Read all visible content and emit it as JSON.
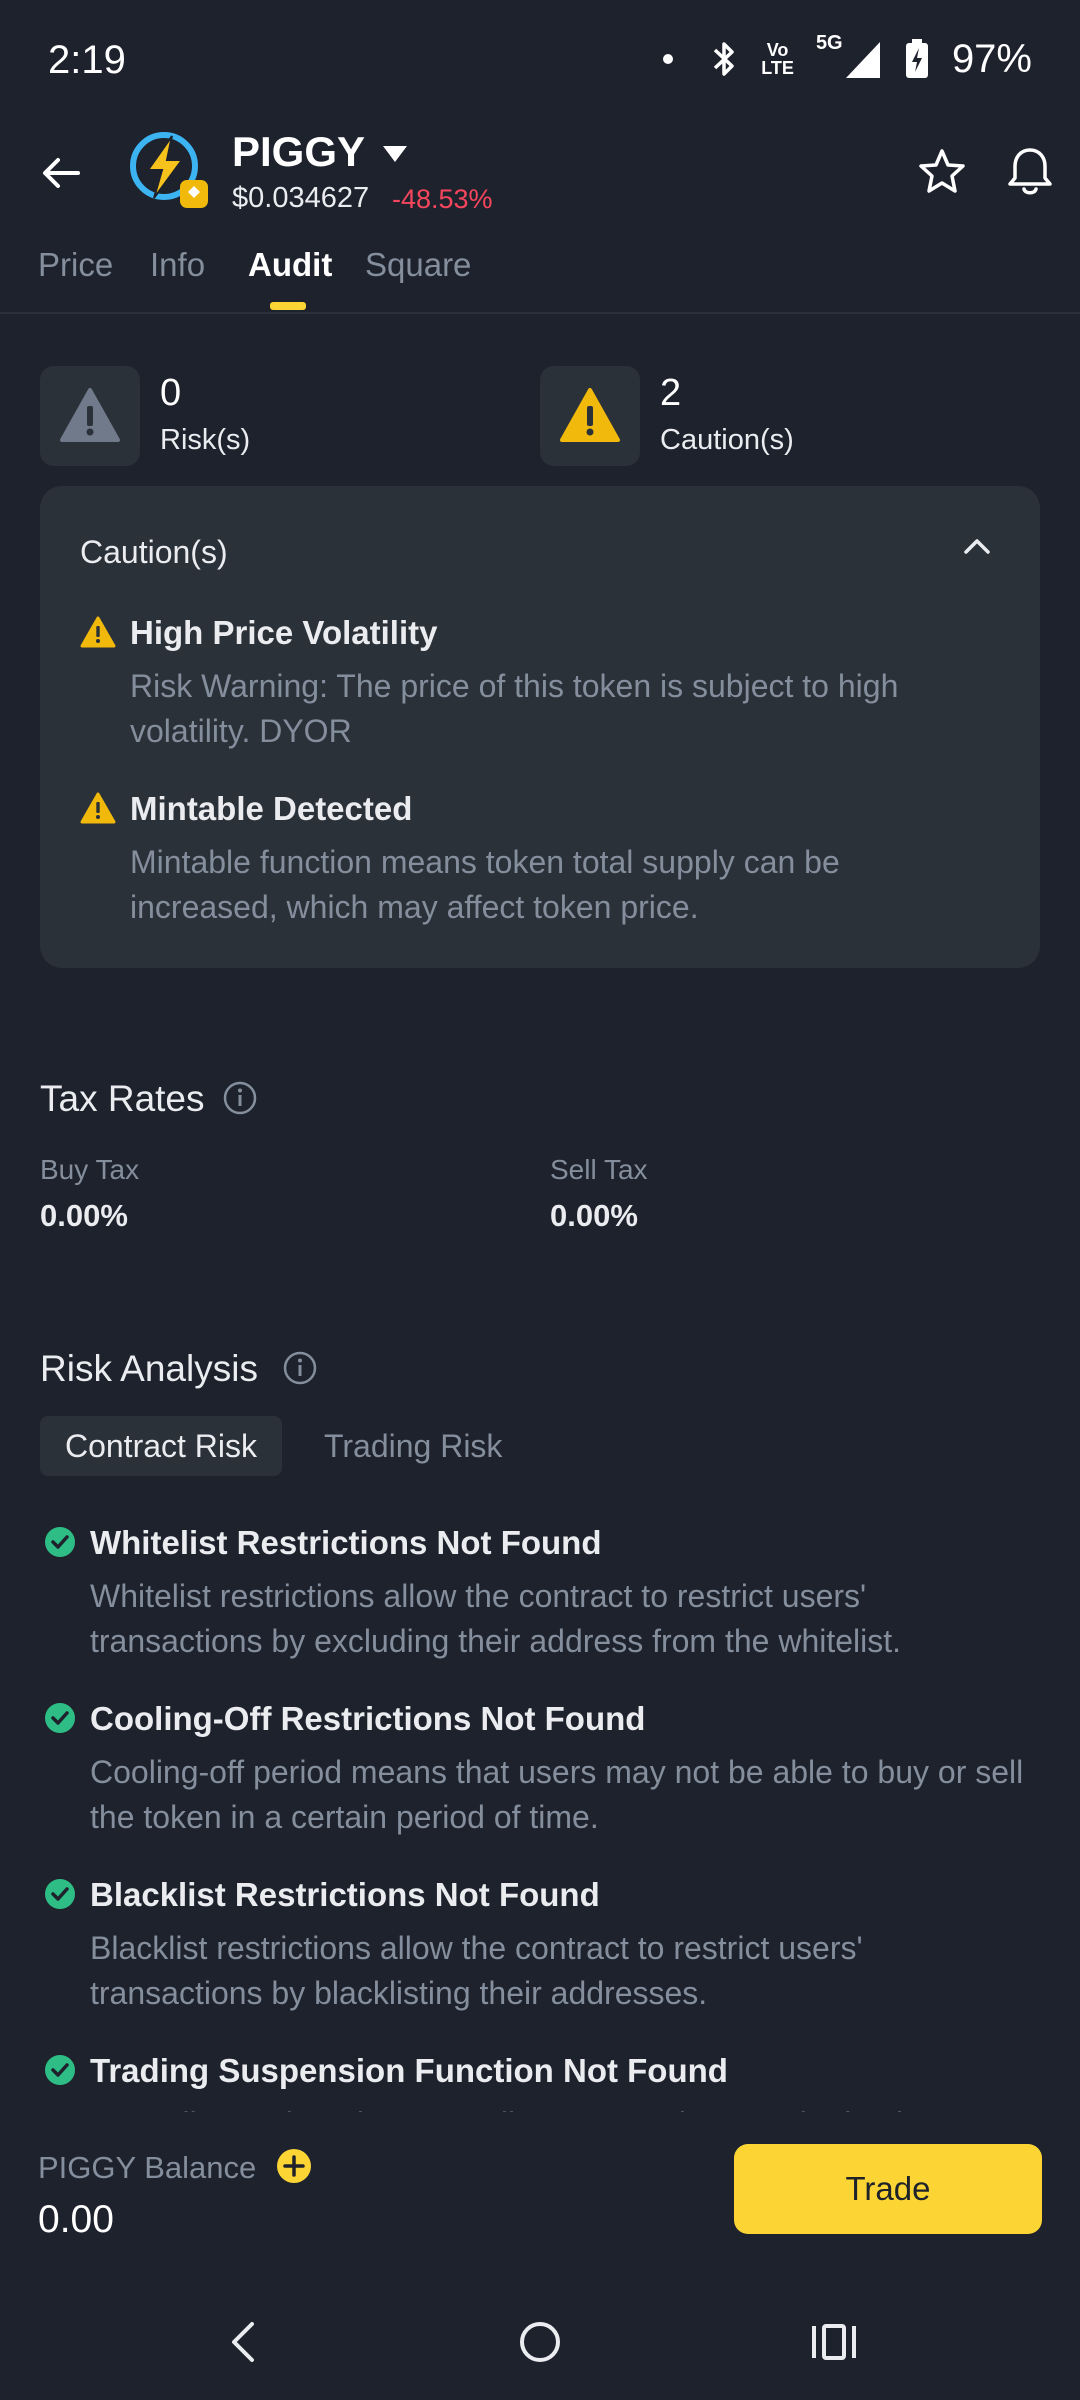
{
  "status_bar": {
    "time": "2:19",
    "network_top": "Vo",
    "network_bottom": "LTE",
    "signal": "5G",
    "battery": "97%"
  },
  "header": {
    "token_name": "PIGGY",
    "price": "$0.034627",
    "change": "-48.53%",
    "change_color": "#f6465d"
  },
  "tabs": [
    {
      "label": "Price"
    },
    {
      "label": "Info"
    },
    {
      "label": "Audit"
    },
    {
      "label": "Square"
    }
  ],
  "active_tab": "Audit",
  "summary": {
    "risks_count": "0",
    "risks_label": "Risk(s)",
    "cautions_count": "2",
    "cautions_label": "Caution(s)"
  },
  "caution_panel": {
    "title": "Caution(s)",
    "items": [
      {
        "title": "High Price Volatility",
        "desc": "Risk Warning: The price of this token is subject to high volatility. DYOR"
      },
      {
        "title": "Mintable Detected",
        "desc": "Mintable function means token total supply can be increased, which may affect token price."
      }
    ]
  },
  "tax_rates": {
    "title": "Tax Rates",
    "buy_label": "Buy Tax",
    "buy_value": "0.00%",
    "sell_label": "Sell Tax",
    "sell_value": "0.00%"
  },
  "risk_analysis": {
    "title": "Risk Analysis",
    "tab_contract": "Contract Risk",
    "tab_trading": "Trading Risk",
    "items": [
      {
        "title": "Whitelist Restrictions Not Found",
        "desc": "Whitelist restrictions allow the contract to restrict users' transactions by excluding their address from the whitelist."
      },
      {
        "title": "Cooling-Off Restrictions Not Found",
        "desc": "Cooling-off period means that users may not be able to buy or sell the token in a certain period of time."
      },
      {
        "title": "Blacklist Restrictions Not Found",
        "desc": "Blacklist restrictions allow the contract to restrict users' transactions by blacklisting their addresses."
      },
      {
        "title": "Trading Suspension Function Not Found",
        "desc": "According to the token, a trading suspension may be in place..."
      }
    ]
  },
  "bottom_bar": {
    "balance_label": "PIGGY Balance",
    "balance_value": "0.00",
    "trade_label": "Trade"
  },
  "colors": {
    "background": "#1e222d",
    "card": "#2b3139",
    "accent_yellow": "#fcd535",
    "success_green": "#2ebd85",
    "danger_red": "#f6465d",
    "muted_text": "#848e9c"
  }
}
